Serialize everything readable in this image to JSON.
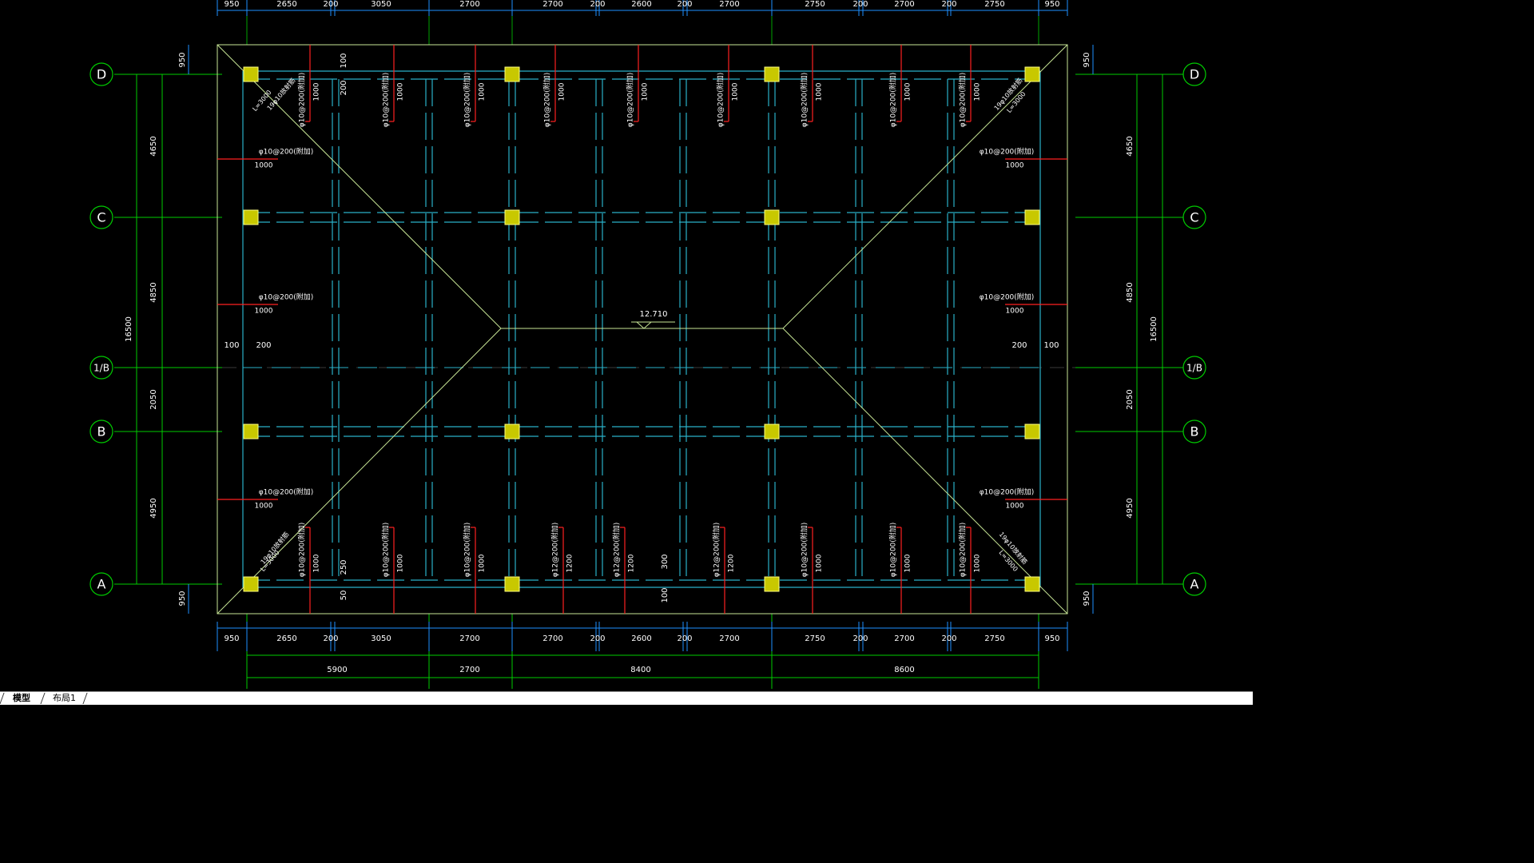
{
  "drawing": {
    "elevation": "12.710",
    "grid_bubbles": [
      "D",
      "C",
      "1/B",
      "B",
      "A"
    ],
    "colors": {
      "background": "#000000",
      "grid": "#00cc00",
      "dim": "#1e90ff",
      "rebar": "#ff2020",
      "column": "#c8c800",
      "beam": "#2ab0c8",
      "text": "#ffffff",
      "outline": "#c8e696"
    },
    "dims": {
      "top_row": [
        "950",
        "2650",
        "200",
        "3050",
        "2700",
        "2700",
        "200",
        "2600",
        "200",
        "2700",
        "2750",
        "200",
        "2700",
        "200",
        "2750",
        "950"
      ],
      "bottom_row": [
        "950",
        "2650",
        "200",
        "3050",
        "2700",
        "2700",
        "200",
        "2600",
        "200",
        "2700",
        "2750",
        "200",
        "2700",
        "200",
        "2750",
        "950"
      ],
      "bottom_totals": [
        "5900",
        "2700",
        "8400",
        "8600"
      ],
      "left_inner": [
        "4650",
        "4850",
        "2050",
        "4950"
      ],
      "left_total": "16500",
      "right_inner": [
        "4650",
        "4850",
        "2050",
        "4950"
      ],
      "right_total": "16500",
      "edge_950": "950",
      "misc_100": "100",
      "misc_200": "200",
      "misc_250": "250",
      "misc_50": "50",
      "misc_300": "300"
    },
    "rebar": {
      "phi10_200": "φ10@200(附加)",
      "phi12_200": "φ12@200(附加)",
      "len_1000": "1000",
      "len_1200": "1200",
      "corner_bar": "19φ10放射筋",
      "corner_len": "L=3000"
    }
  },
  "tabs": {
    "model": "模型",
    "layout1": "布局1"
  }
}
